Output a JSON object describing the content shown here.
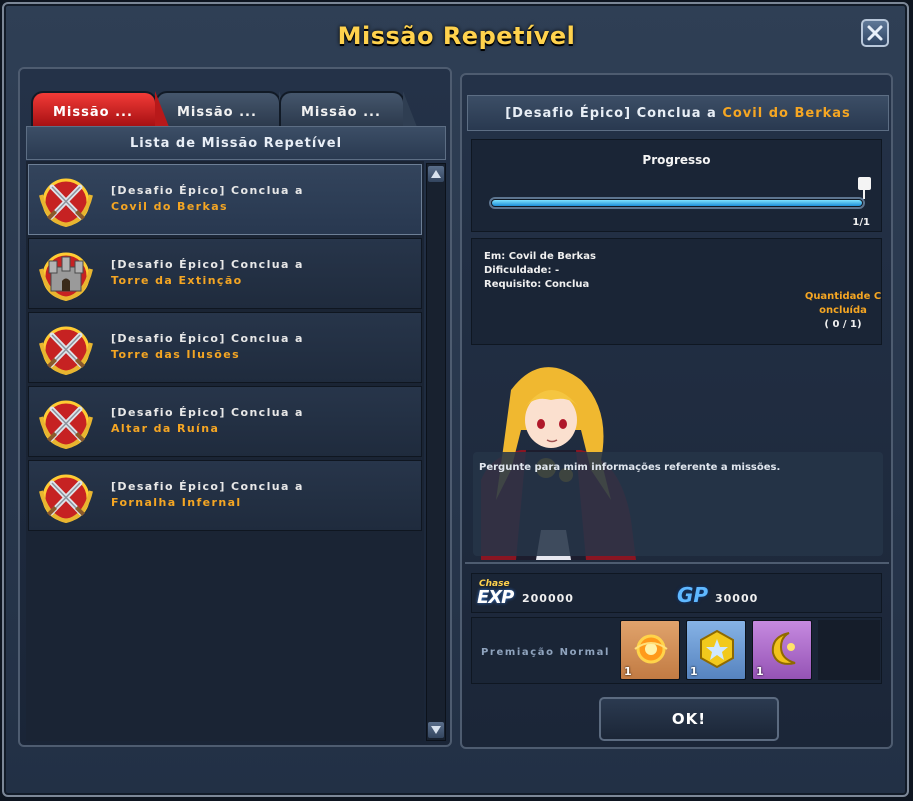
{
  "window": {
    "title": "Missão Repetível",
    "close_icon": "close-icon"
  },
  "tabs": [
    {
      "label": "Missão ...",
      "active": true
    },
    {
      "label": "Missão ...",
      "active": false
    },
    {
      "label": "Missão ...",
      "active": false
    }
  ],
  "list": {
    "header": "Lista de Missão Repetível",
    "items": [
      {
        "line1": "[Desafio Épico] Conclua a",
        "line2": "Covil do Berkas",
        "icon": "crossed-swords-icon",
        "selected": true
      },
      {
        "line1": "[Desafio Épico] Conclua a",
        "line2": "Torre da Extinção",
        "icon": "castle-icon",
        "selected": false
      },
      {
        "line1": "[Desafio Épico] Conclua a",
        "line2": "Torre das Ilusões",
        "icon": "crossed-swords-icon",
        "selected": false
      },
      {
        "line1": "[Desafio Épico] Conclua a",
        "line2": "Altar da Ruína",
        "icon": "crossed-swords-icon",
        "selected": false
      },
      {
        "line1": "[Desafio Épico] Conclua a",
        "line2": "Fornalha Infernal",
        "icon": "crossed-swords-icon",
        "selected": false
      }
    ]
  },
  "detail": {
    "header_prefix": "[Desafio Épico] Conclua a",
    "header_highlight": "Covil do Berkas",
    "progress": {
      "label": "Progresso",
      "count": "1/1",
      "fraction": 1.0
    },
    "info": {
      "location": "Em: Covil de Berkas",
      "difficulty": "Dificuldade: -",
      "requirement": "Requisito: Conclua",
      "qty_title": "Quantidade Concluída",
      "qty_value": "( 0 / 1)"
    },
    "npc_text": "Pergunte para mim informações referente a missões."
  },
  "rewards": {
    "exp_small": "Chase",
    "exp_big": "EXP",
    "exp_value": "200000",
    "gp_label": "GP",
    "gp_value": "30000",
    "items_label": "Premiação Normal",
    "items": [
      {
        "icon": "orb-icon",
        "qty": "1",
        "color": "#d9935a"
      },
      {
        "icon": "star-gem-icon",
        "qty": "1",
        "color": "#6f9fd6"
      },
      {
        "icon": "moon-icon",
        "qty": "1",
        "color": "#a768c4"
      }
    ]
  },
  "ok_button": "OK!"
}
